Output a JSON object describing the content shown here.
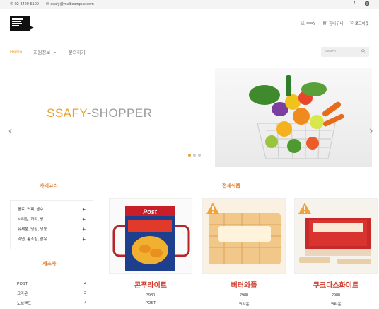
{
  "topbar": {
    "phone": "02-3429-5100",
    "email": "ssafy@multicampus.com",
    "social": [
      "facebook-icon",
      "instagram-icon"
    ]
  },
  "header": {
    "user": "ssafy",
    "cart": "장바구니",
    "logout": "로그아웃"
  },
  "nav": {
    "items": [
      "Home",
      "회원정보",
      "문의하기"
    ],
    "search_placeholder": "Search"
  },
  "hero": {
    "title_a": "SSAFY",
    "title_b": "-SHOPPER"
  },
  "sidebar": {
    "category_title": "카테고리",
    "categories": [
      "음료, 커피, 생수",
      "시리얼, 과자, 빵",
      "유제품, 냉장, 냉동",
      "라면, 통조림, 참유"
    ],
    "maker_title": "제조사",
    "makers": [
      {
        "name": "POST",
        "count": "4"
      },
      {
        "name": "크라운",
        "count": "2"
      },
      {
        "name": "노브랜드",
        "count": "4"
      }
    ]
  },
  "main": {
    "title": "전체식품",
    "products": [
      {
        "name": "콘푸라이트",
        "price": "3980",
        "maker": "POST"
      },
      {
        "name": "버터와플",
        "price": "2980",
        "maker": "크라운"
      },
      {
        "name": "쿠크다스화이트",
        "price": "2980",
        "maker": "크라운"
      }
    ]
  }
}
